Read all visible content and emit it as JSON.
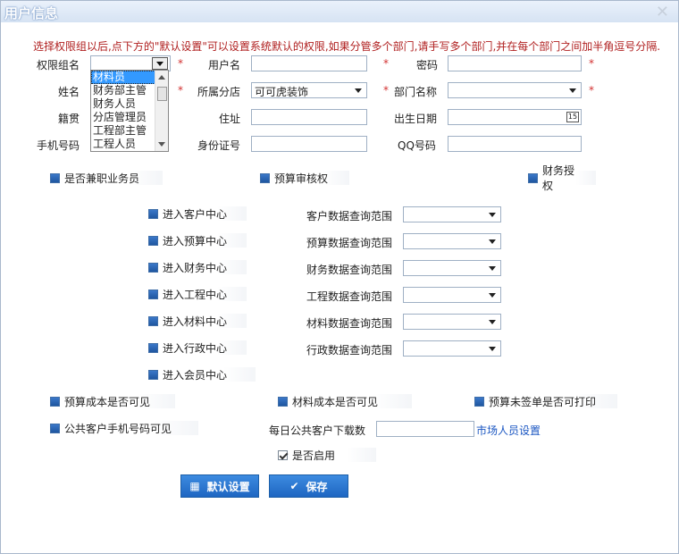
{
  "window": {
    "title": "用户信息",
    "close": "✕"
  },
  "notice": "选择权限组以后,点下方的\"默认设置\"可以设置系统默认的权限,如果分管多个部门,请手写多个部门,并在每个部门之间加半角逗号分隔.",
  "form": {
    "permission_group_label": "权限组名",
    "username_label": "用户名",
    "password_label": "密码",
    "name_label": "姓名",
    "branch_label": "所属分店",
    "branch_value": "可可虎装饰",
    "department_label": "部门名称",
    "native_label": "籍贯",
    "address_label": "住址",
    "birthdate_label": "出生日期",
    "calendar_icon_text": "15",
    "phone_label": "手机号码",
    "idcard_label": "身份证号",
    "qq_label": "QQ号码",
    "required_mark": "*"
  },
  "permission_list": [
    "材料员",
    "财务部主管",
    "财务人员",
    "分店管理员",
    "工程部主管",
    "工程人员"
  ],
  "checks": {
    "agent": "是否兼职业务员",
    "budget_audit": "预算审核权",
    "finance_auth": "财务授权",
    "enter_customer": "进入客户中心",
    "enter_budget": "进入预算中心",
    "enter_finance": "进入财务中心",
    "enter_project": "进入工程中心",
    "enter_material": "进入材料中心",
    "enter_admin": "进入行政中心",
    "enter_member": "进入会员中心",
    "budget_cost_visible": "预算成本是否可见",
    "material_cost_visible": "材料成本是否可见",
    "budget_unsigned_print": "预算未签单是否可打印",
    "public_phone_visible": "公共客户手机号码可见",
    "enabled": "是否启用"
  },
  "ranges": {
    "customer": "客户数据查询范围",
    "budget": "预算数据查询范围",
    "finance": "财务数据查询范围",
    "project": "工程数据查询范围",
    "material": "材料数据查询范围",
    "admin": "行政数据查询范围"
  },
  "daily_download_label": "每日公共客户下载数",
  "market_staff_link": "市场人员设置",
  "buttons": {
    "default_settings": "默认设置",
    "save": "保存"
  }
}
